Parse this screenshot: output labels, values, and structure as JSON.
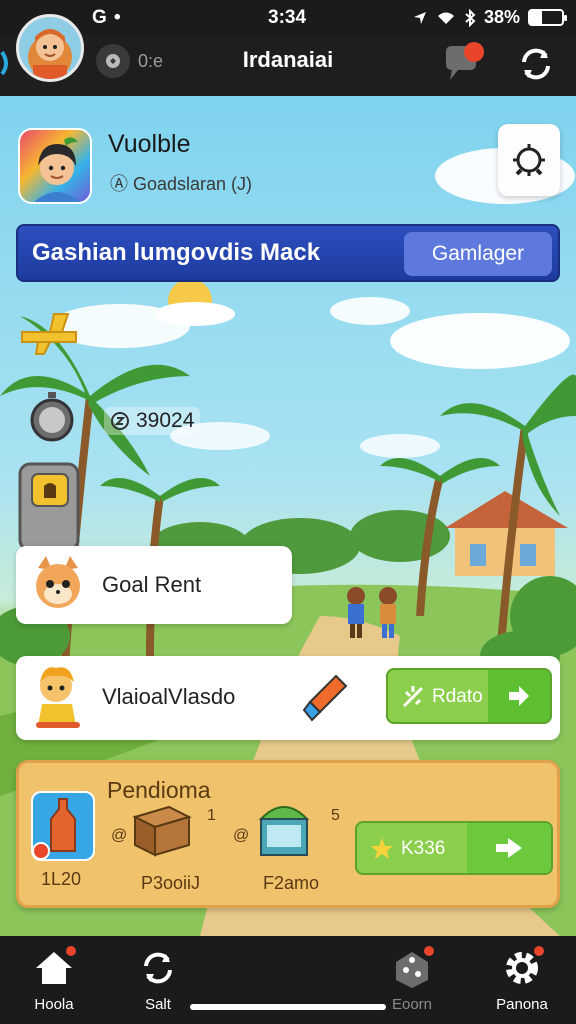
{
  "status_bar": {
    "left_text": "G •",
    "time": "3:34",
    "battery_text": "38%",
    "battery_level_percent": 38
  },
  "header": {
    "currency_value": "0:e",
    "title": "Irdanaiai",
    "chat_has_notification": true
  },
  "profile": {
    "name": "Vuolble",
    "subtitle": "Ⓐ Goadslaran (J)"
  },
  "banner": {
    "text": "Gashian lumgovdis Mack",
    "button_label": "Gamlager"
  },
  "coins": {
    "icon": "coin-icon",
    "value": "39024"
  },
  "goal_card": {
    "label": "Goal Rent"
  },
  "task_card": {
    "label": "VlaioalVlasdo",
    "button_label": "Rdato"
  },
  "pending": {
    "title": "Pendioma",
    "main_value": "1L20",
    "items": [
      {
        "label": "P3ooiiJ",
        "count": "1",
        "icon": "crate-icon"
      },
      {
        "label": "F2amo",
        "count": "5",
        "icon": "shop-icon"
      }
    ],
    "claim_label": "K336"
  },
  "bottom_nav": [
    {
      "label": "Hoola",
      "icon": "home-icon",
      "badge": true
    },
    {
      "label": "Salt",
      "icon": "sync-icon",
      "badge": false
    },
    {
      "label": "Eoorn",
      "icon": "dice-icon",
      "badge": true
    },
    {
      "label": "Panona",
      "icon": "gear-icon",
      "badge": true
    }
  ],
  "colors": {
    "banner": "#2d4fbf",
    "green_button": "#8bcf4c",
    "panel": "#f0c26b",
    "badge": "#e8452b"
  }
}
